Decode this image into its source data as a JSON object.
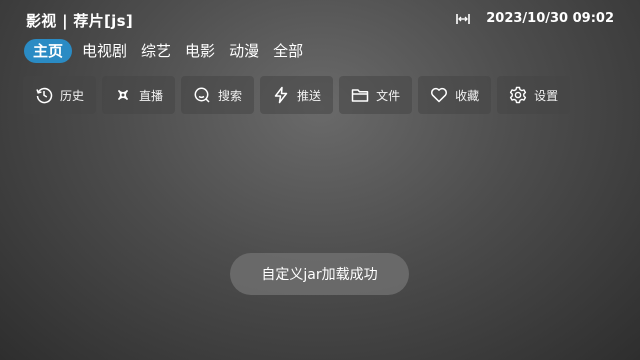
{
  "header": {
    "title": "影视 | 荐片[js]",
    "datetime": "2023/10/30 09:02",
    "width_icon": "horizontal-arrows-icon"
  },
  "tabs": [
    {
      "label": "主页",
      "active": true
    },
    {
      "label": "电视剧",
      "active": false
    },
    {
      "label": "综艺",
      "active": false
    },
    {
      "label": "电影",
      "active": false
    },
    {
      "label": "动漫",
      "active": false
    },
    {
      "label": "全部",
      "active": false
    }
  ],
  "toolbar": [
    {
      "label": "历史",
      "icon": "history-icon"
    },
    {
      "label": "直播",
      "icon": "live-icon"
    },
    {
      "label": "搜索",
      "icon": "search-icon"
    },
    {
      "label": "推送",
      "icon": "lightning-icon"
    },
    {
      "label": "文件",
      "icon": "folder-icon"
    },
    {
      "label": "收藏",
      "icon": "heart-icon"
    },
    {
      "label": "设置",
      "icon": "gear-icon"
    }
  ],
  "toast": {
    "message": "自定义jar加载成功"
  },
  "colors": {
    "accent": "#2a8bc4",
    "background": "#4d4d4d"
  }
}
